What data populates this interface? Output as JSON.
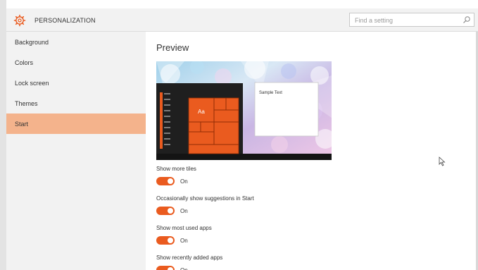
{
  "header": {
    "title": "PERSONALIZATION",
    "search_placeholder": "Find a setting"
  },
  "sidebar": {
    "items": [
      {
        "label": "Background"
      },
      {
        "label": "Colors"
      },
      {
        "label": "Lock screen"
      },
      {
        "label": "Themes"
      },
      {
        "label": "Start"
      }
    ],
    "active": "Start"
  },
  "main": {
    "heading": "Preview",
    "preview_sample_text": "Sample Text",
    "preview_tile_label": "Aa",
    "settings": [
      {
        "label": "Show more tiles",
        "state": "On"
      },
      {
        "label": "Occasionally show suggestions in Start",
        "state": "On"
      },
      {
        "label": "Show most used apps",
        "state": "On"
      },
      {
        "label": "Show recently added apps",
        "state": "On"
      }
    ]
  },
  "colors": {
    "accent": "#ea5b1f",
    "active_nav": "#f4b38c",
    "sidebar_bg": "#f2f2f2"
  },
  "icons": {
    "header": "gear-icon",
    "search": "search-icon"
  }
}
